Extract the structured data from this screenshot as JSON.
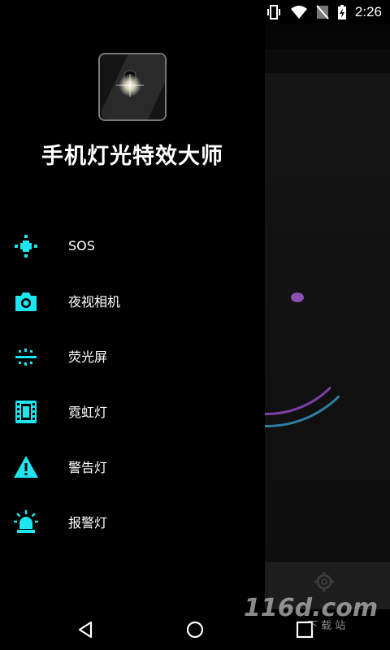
{
  "status_bar": {
    "time": "2:26",
    "icons": [
      "vibrate-icon",
      "wifi-icon",
      "no-sim-icon",
      "battery-charging-icon"
    ]
  },
  "drawer": {
    "app_title": "手机灯光特效大师",
    "menu": [
      {
        "label": "SOS",
        "icon": "sos-plus-icon"
      },
      {
        "label": "夜视相机",
        "icon": "camera-icon"
      },
      {
        "label": "荧光屏",
        "icon": "screen-glow-icon"
      },
      {
        "label": "霓虹灯",
        "icon": "film-icon"
      },
      {
        "label": "警告灯",
        "icon": "warning-icon"
      },
      {
        "label": "报警灯",
        "icon": "alarm-light-icon"
      }
    ]
  },
  "nav_bar": {
    "icons": [
      "back-icon",
      "home-icon",
      "recents-icon"
    ]
  },
  "watermark": {
    "text": "116d.com",
    "subtext": "下 载 站"
  },
  "colors": {
    "accent": "#1ee6f0",
    "drawer_bg": "#000000"
  }
}
